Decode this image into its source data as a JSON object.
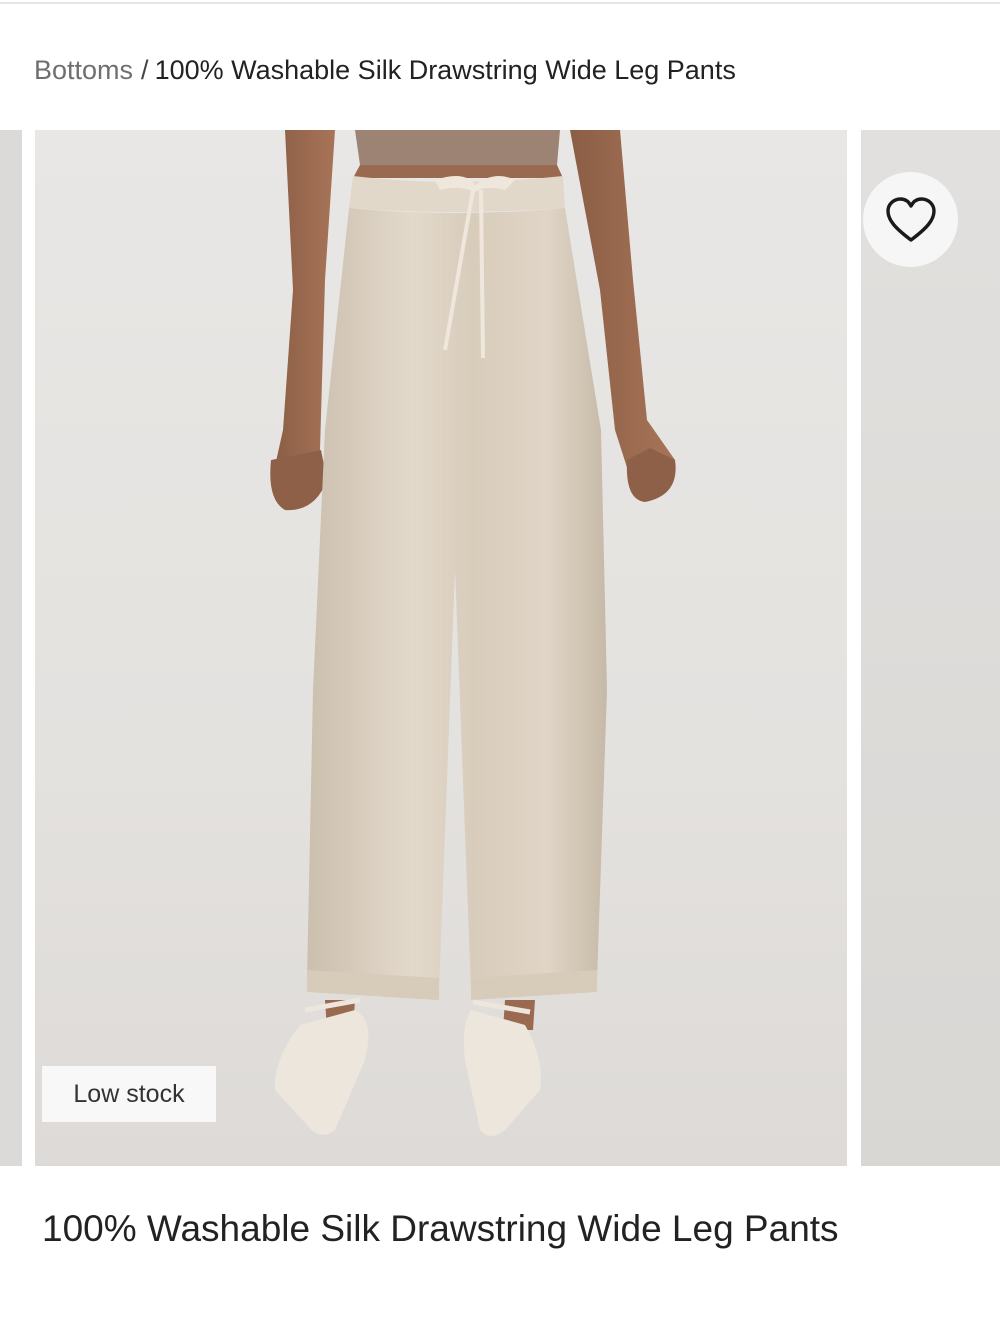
{
  "breadcrumb": {
    "parent": "Bottoms",
    "separator": "/",
    "current": "100% Washable Silk Drawstring Wide Leg Pants"
  },
  "gallery": {
    "badge": "Low stock",
    "favorite_icon": "heart-outline-icon"
  },
  "product": {
    "title": "100% Washable Silk Drawstring Wide Leg Pants"
  },
  "colors": {
    "pants": "#d9cdbd",
    "photo_background": "#e6e4e1",
    "shoes": "#ece6dc"
  }
}
